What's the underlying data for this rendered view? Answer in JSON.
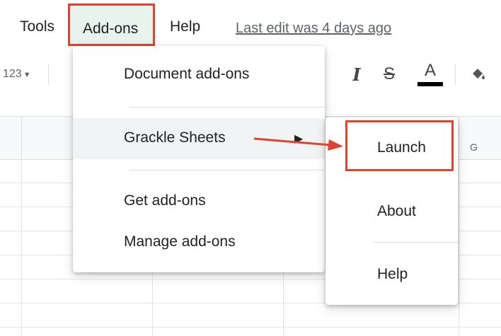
{
  "menubar": {
    "items": [
      {
        "label": "Tools"
      },
      {
        "label": "Add-ons"
      },
      {
        "label": "Help"
      }
    ],
    "last_edit": "Last edit was 4 days ago"
  },
  "toolbar": {
    "number_format": "123",
    "icons": [
      "italic-icon",
      "strikethrough-icon",
      "text-color-icon",
      "fill-color-icon"
    ],
    "text_color": "#000000"
  },
  "sheet": {
    "visible_column_header": "G"
  },
  "addons_menu": {
    "items": [
      {
        "label": "Document add-ons"
      },
      {
        "label": "Grackle Sheets"
      },
      {
        "label": "Get add-ons"
      },
      {
        "label": "Manage add-ons"
      }
    ],
    "submenu": {
      "items": [
        {
          "label": "Launch"
        },
        {
          "label": "About"
        },
        {
          "label": "Help"
        }
      ]
    }
  },
  "annotation": {
    "highlight_color": "#e0422f"
  }
}
